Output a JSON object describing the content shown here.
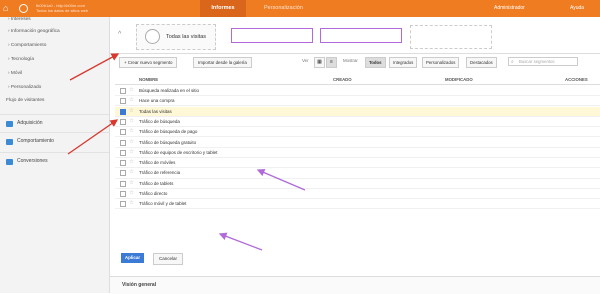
{
  "topbar": {
    "account_line1": "fb00b1a0 - http://b00m.com",
    "account_line2": "Todos los datos de sitios web",
    "tabs": [
      {
        "label": "Informes"
      },
      {
        "label": "Personalización"
      }
    ],
    "admin_label": "Administrador",
    "help_label": "Ayuda"
  },
  "sidebar": {
    "sub_items": [
      "› Intereses",
      "› Información geográfica",
      "› Comportamiento",
      "› Tecnología",
      "› Móvil",
      "› Personalizado",
      "Flujo de visitantes"
    ],
    "main_items": [
      {
        "label": "Adquisición",
        "icon": "acquisition-icon"
      },
      {
        "label": "Comportamiento",
        "icon": "behavior-icon"
      },
      {
        "label": "Conversiones",
        "icon": "conversions-icon"
      }
    ]
  },
  "segments": {
    "collapse_glyph": "^",
    "active_label": "Todas las visitas",
    "slot_placeholder": ""
  },
  "toolbar": {
    "new_segment": "+ Crear nuevo segmento",
    "import_gallery": "Importar desde la galería",
    "view_label": "Ver",
    "show_label": "Mostrar",
    "filters": [
      "Todos",
      "Integrados",
      "Personalizados",
      "Destacados"
    ],
    "selected_filter": "Todos",
    "search_placeholder": "Buscar segmentos"
  },
  "table": {
    "headers": {
      "name": "NOMBRE",
      "created": "CREADO",
      "modified": "MODIFICADO",
      "actions": "ACCIONES"
    },
    "rows": [
      {
        "name": "Búsqueda realizada en el sitio",
        "checked": false
      },
      {
        "name": "Hace una compra",
        "checked": false
      },
      {
        "name": "Todas las visitas",
        "checked": true
      },
      {
        "name": "Tráfico de búsqueda",
        "checked": false
      },
      {
        "name": "Tráfico de búsqueda de pago",
        "checked": false
      },
      {
        "name": "Tráfico de búsqueda gratuito",
        "checked": false
      },
      {
        "name": "Tráfico de equipos de escritorio y tablet",
        "checked": false
      },
      {
        "name": "Tráfico de móviles",
        "checked": false
      },
      {
        "name": "Tráfico de referencia",
        "checked": false
      },
      {
        "name": "Tráfico de tablets",
        "checked": false
      },
      {
        "name": "Tráfico directo",
        "checked": false
      },
      {
        "name": "Tráfico móvil y de tablet",
        "checked": false
      }
    ]
  },
  "actions": {
    "apply": "Aplicar",
    "cancel": "Cancelar"
  },
  "footer": {
    "label": "Visión general"
  },
  "colors": {
    "brand_orange": "#f07c22",
    "accent_blue": "#3b7bd6",
    "annotation_purple": "#b06ad9",
    "annotation_red": "#d9382e"
  }
}
